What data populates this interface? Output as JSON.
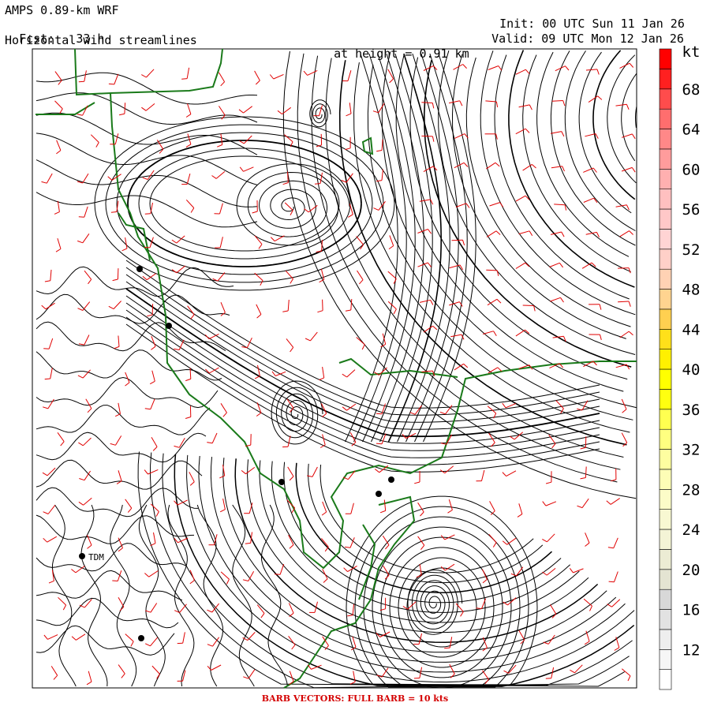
{
  "header": {
    "model": "AMPS 0.89-km WRF",
    "fcst_label": "Fcst:",
    "fcst_value": "33 h",
    "product": "Horizontal wind streamlines",
    "height_label": "at height =",
    "height_value": "0.91 km",
    "init_label": "Init:",
    "init_value": "00 UTC Sun 11 Jan 26",
    "valid_label": "Valid:",
    "valid_value": "09 UTC Mon 12 Jan 26"
  },
  "footer": "BARB VECTORS:  FULL BARB = 10 kts",
  "station_label": "TDM",
  "colors": {
    "streamline": "#000000",
    "barb": "#e00000",
    "coast": "#1a7a1a",
    "footer": "#d40000"
  },
  "colorbar": {
    "unit": "kt",
    "levels": [
      {
        "value": "",
        "color": "#ffffff"
      },
      {
        "value": "12",
        "color": "#f6f6f6"
      },
      {
        "value": "",
        "color": "#eeeeee"
      },
      {
        "value": "16",
        "color": "#e2e2e2"
      },
      {
        "value": "",
        "color": "#d8d8d8"
      },
      {
        "value": "20",
        "color": "#e4e4d2"
      },
      {
        "value": "",
        "color": "#ececd4"
      },
      {
        "value": "24",
        "color": "#f4f4d6"
      },
      {
        "value": "",
        "color": "#f8f8d2"
      },
      {
        "value": "28",
        "color": "#fcfcc8"
      },
      {
        "value": "",
        "color": "#fdfdb6"
      },
      {
        "value": "32",
        "color": "#fefea0"
      },
      {
        "value": "",
        "color": "#ffff80"
      },
      {
        "value": "36",
        "color": "#ffff50"
      },
      {
        "value": "",
        "color": "#ffff10"
      },
      {
        "value": "40",
        "color": "#ffff00"
      },
      {
        "value": "",
        "color": "#fff000"
      },
      {
        "value": "44",
        "color": "#ffe01a"
      },
      {
        "value": "",
        "color": "#ffd050"
      },
      {
        "value": "48",
        "color": "#ffd490"
      },
      {
        "value": "",
        "color": "#ffd2b4"
      },
      {
        "value": "52",
        "color": "#ffd0c8"
      },
      {
        "value": "",
        "color": "#ffd4d4"
      },
      {
        "value": "56",
        "color": "#ffc8c8"
      },
      {
        "value": "",
        "color": "#ffc0c0"
      },
      {
        "value": "60",
        "color": "#ffb0b0"
      },
      {
        "value": "",
        "color": "#ff9c9c"
      },
      {
        "value": "64",
        "color": "#ff8888"
      },
      {
        "value": "",
        "color": "#ff6e6e"
      },
      {
        "value": "68",
        "color": "#ff4c4c"
      },
      {
        "value": "",
        "color": "#ff2020"
      },
      {
        "value": "",
        "color": "#ff0000"
      }
    ]
  }
}
